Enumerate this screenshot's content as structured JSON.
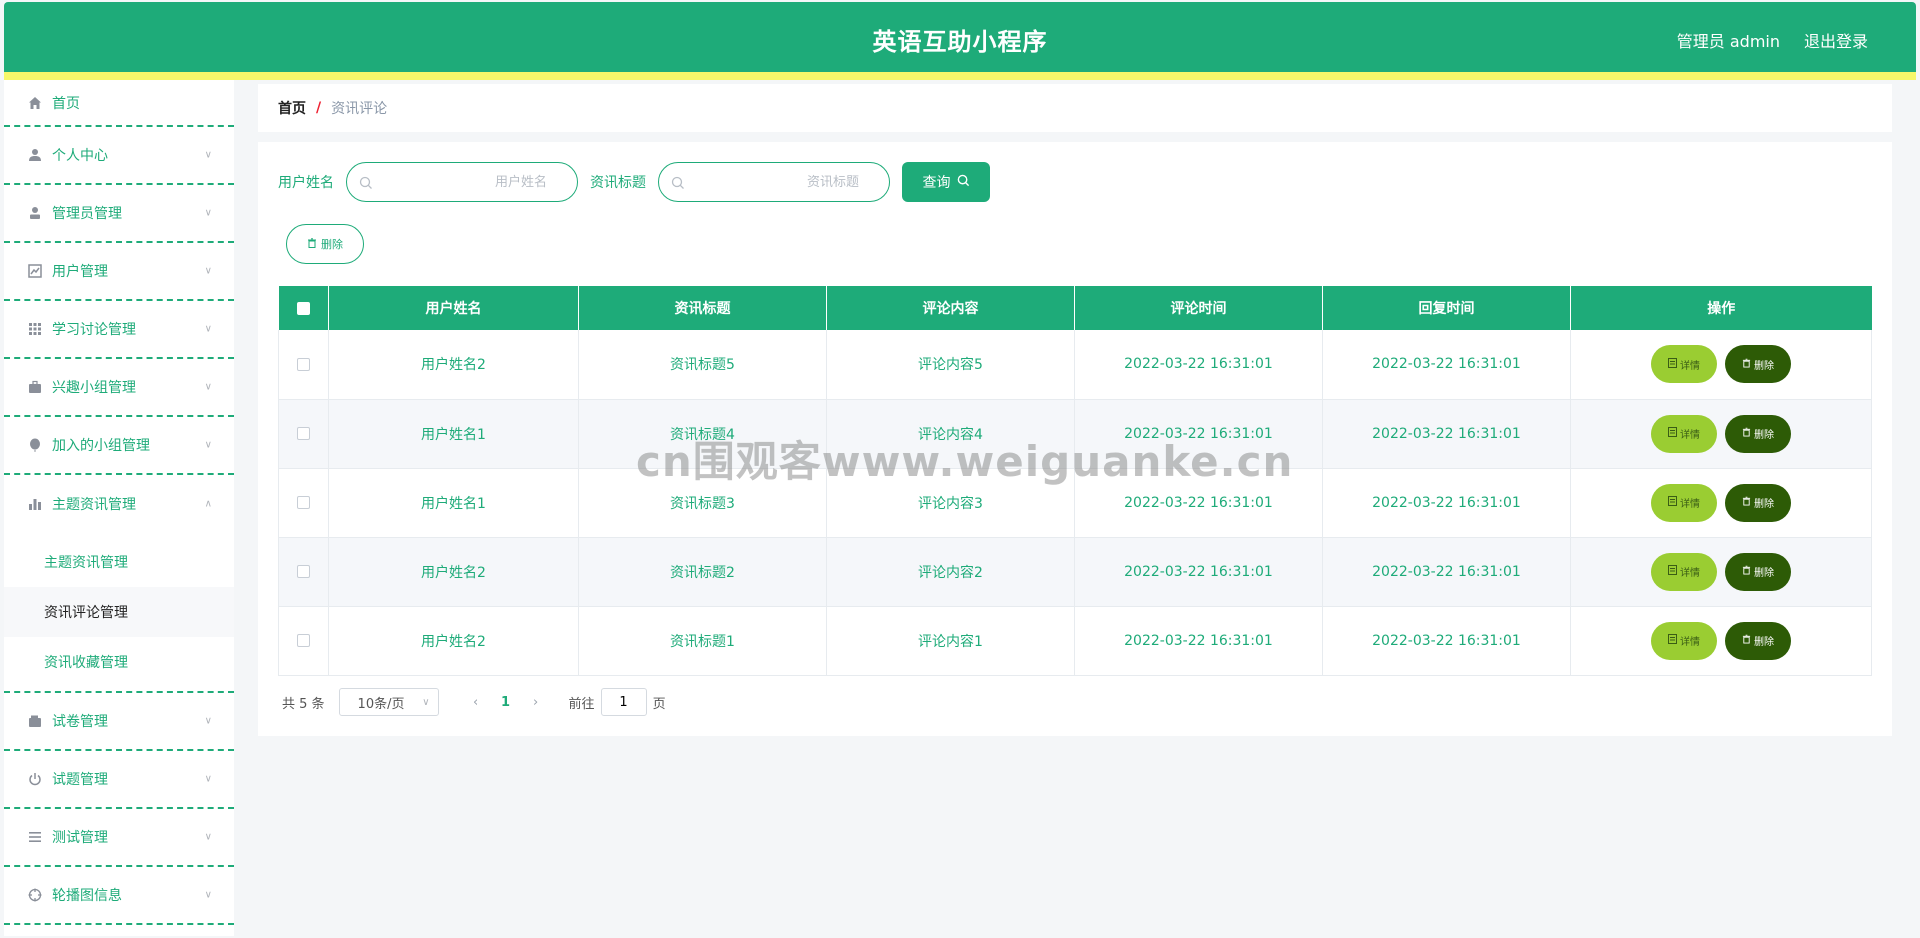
{
  "header": {
    "title": "英语互助小程序",
    "user": "管理员 admin",
    "logout": "退出登录"
  },
  "sidebar": {
    "items": [
      {
        "label": "首页",
        "icon": "home-icon"
      },
      {
        "label": "个人中心",
        "icon": "user-icon"
      },
      {
        "label": "管理员管理",
        "icon": "admin-icon"
      },
      {
        "label": "用户管理",
        "icon": "chart-icon"
      },
      {
        "label": "学习讨论管理",
        "icon": "grid-icon"
      },
      {
        "label": "兴趣小组管理",
        "icon": "briefcase-icon"
      },
      {
        "label": "加入的小组管理",
        "icon": "balloon-icon"
      },
      {
        "label": "主题资讯管理",
        "icon": "bar-chart-icon"
      },
      {
        "label": "试卷管理",
        "icon": "wallet-icon"
      },
      {
        "label": "试题管理",
        "icon": "power-icon"
      },
      {
        "label": "测试管理",
        "icon": "list-icon"
      },
      {
        "label": "轮播图信息",
        "icon": "target-icon"
      }
    ],
    "submenu": [
      "主题资讯管理",
      "资讯评论管理",
      "资讯收藏管理"
    ]
  },
  "breadcrumb": {
    "home": "首页",
    "sep": "/",
    "current": "资讯评论"
  },
  "search": {
    "username_label": "用户姓名",
    "username_placeholder": "用户姓名",
    "title_label": "资讯标题",
    "title_placeholder": "资讯标题",
    "query_label": "查询"
  },
  "toolbar": {
    "delete_label": "删除"
  },
  "table": {
    "headers": [
      "用户姓名",
      "资讯标题",
      "评论内容",
      "评论时间",
      "回复时间",
      "操作"
    ],
    "rows": [
      [
        "用户姓名2",
        "资讯标题5",
        "评论内容5",
        "2022-03-22 16:31:01",
        "2022-03-22 16:31:01"
      ],
      [
        "用户姓名1",
        "资讯标题4",
        "评论内容4",
        "2022-03-22 16:31:01",
        "2022-03-22 16:31:01"
      ],
      [
        "用户姓名1",
        "资讯标题3",
        "评论内容3",
        "2022-03-22 16:31:01",
        "2022-03-22 16:31:01"
      ],
      [
        "用户姓名2",
        "资讯标题2",
        "评论内容2",
        "2022-03-22 16:31:01",
        "2022-03-22 16:31:01"
      ],
      [
        "用户姓名2",
        "资讯标题1",
        "评论内容1",
        "2022-03-22 16:31:01",
        "2022-03-22 16:31:01"
      ]
    ],
    "detail_label": "详情",
    "delete_label": "删除"
  },
  "pager": {
    "total": "共 5 条",
    "size": "10条/页",
    "page": "1",
    "goto": "前往",
    "goto_value": "1",
    "unit": "页"
  },
  "watermark": "cn围观客www.weiguanke.cn",
  "colors": {
    "primary": "#1eab79",
    "stripe": "#f6f76a",
    "detail": "#9acd32",
    "delete": "#2d5b06"
  }
}
